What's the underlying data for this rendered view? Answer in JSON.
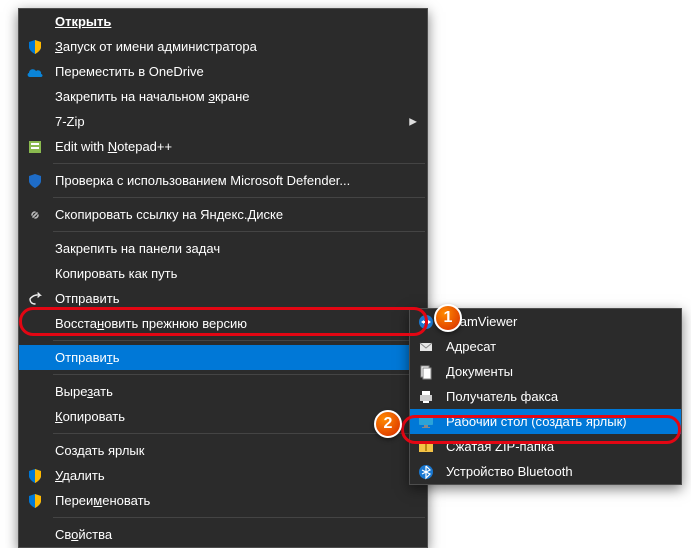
{
  "main_menu": {
    "open": "Открыть",
    "run_as_admin": "Запуск от имени администратора",
    "move_to_onedrive": "Переместить в OneDrive",
    "pin_start": "Закрепить на начальном экране",
    "seven_zip": "7-Zip",
    "edit_notepadpp_pre": "Edit with ",
    "edit_notepadpp_u": "N",
    "edit_notepadpp_post": "otepad++",
    "defender": "Проверка с использованием Microsoft Defender...",
    "yandex": "Скопировать ссылку на Яндекс.Диске",
    "pin_taskbar": "Закрепить на панели задач",
    "copy_as_path": "Копировать как путь",
    "send_share": "Отправить",
    "restore_pre": "Восста",
    "restore_u": "н",
    "restore_post": "овить прежнюю версию",
    "send_to_pre": "Отправи",
    "send_to_u": "т",
    "send_to_post": "ь",
    "cut_pre": "Выре",
    "cut_u": "з",
    "cut_post": "ать",
    "copy_u": "К",
    "copy_post": "опировать",
    "create_shortcut": "Создать ярлык",
    "delete_u": "У",
    "delete_post": "далить",
    "rename_pre": "Переи",
    "rename_u": "м",
    "rename_post": "еновать",
    "properties_pre": "Св",
    "properties_u": "о",
    "properties_post": "йства"
  },
  "sub_menu": {
    "teamviewer": "TeamViewer",
    "recipient": "Адресат",
    "documents": "Документы",
    "fax": "Получатель факса",
    "desktop": "Рабочий стол (создать ярлык)",
    "zip": "Сжатая ZIP-папка",
    "bluetooth": "Устройство Bluetooth"
  },
  "callouts": {
    "one": "1",
    "two": "2"
  }
}
